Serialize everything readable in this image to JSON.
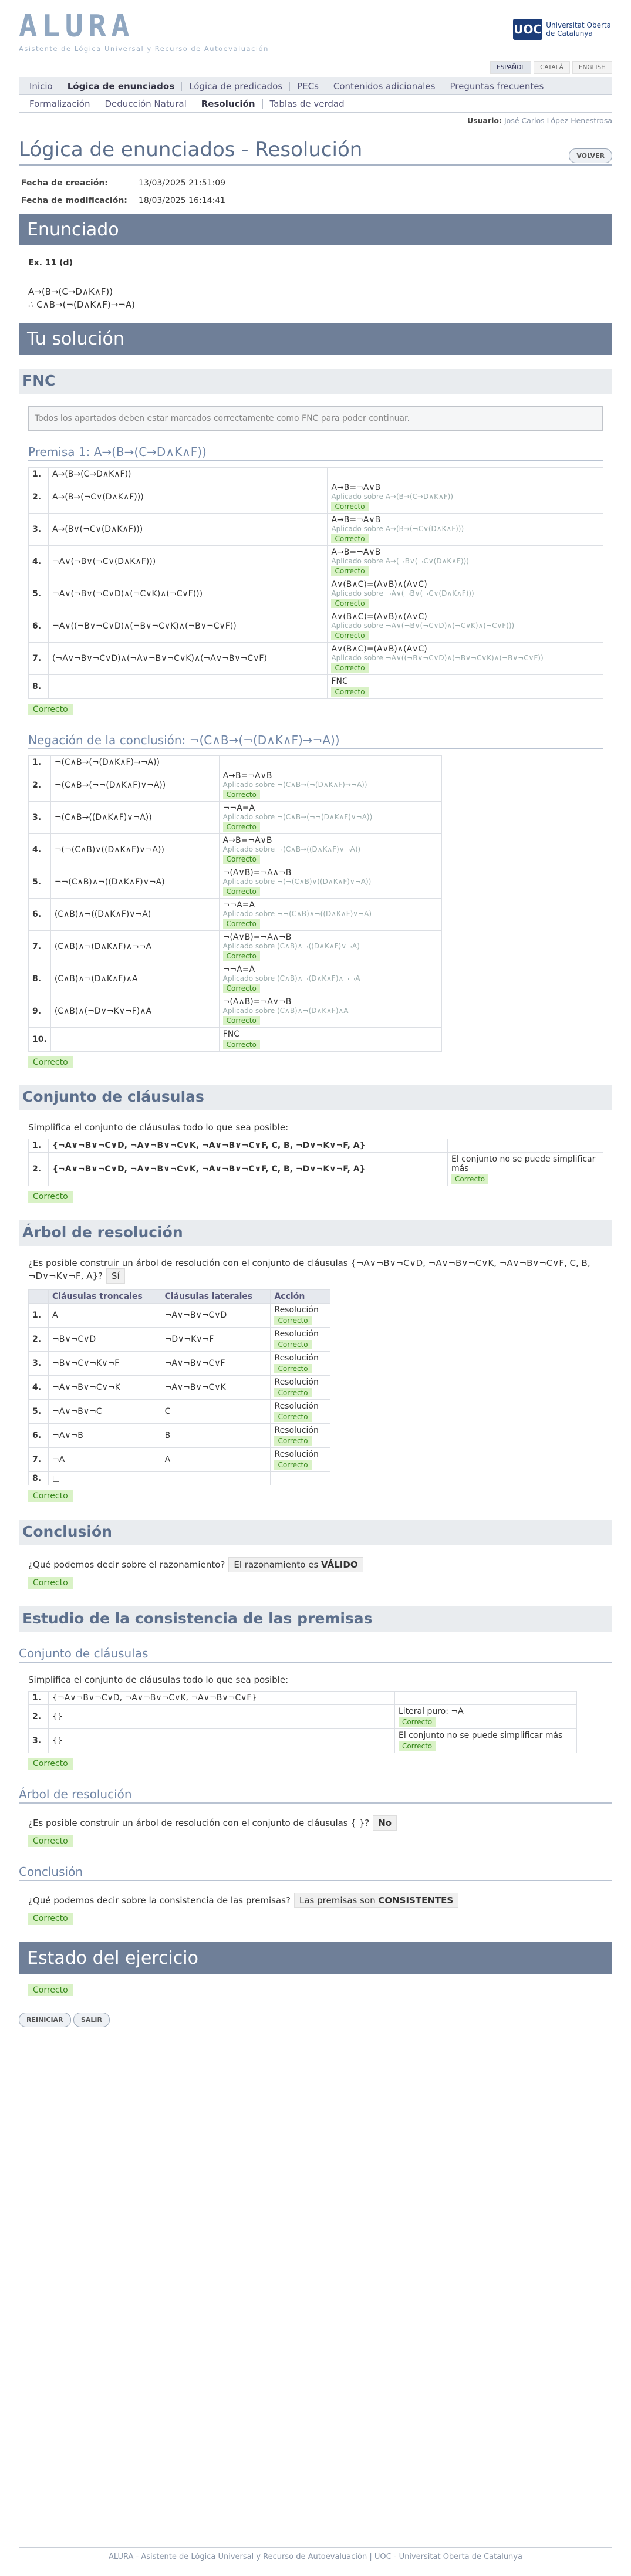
{
  "header": {
    "logo": "ALURA",
    "logo_sub": "Asistente de Lógica Universal y Recurso de Autoevaluación",
    "uoc_mark": "UOC",
    "uoc_line1": "Universitat Oberta",
    "uoc_line2": "de Catalunya"
  },
  "langs": [
    "ESPAÑOL",
    "CATALÀ",
    "ENGLISH"
  ],
  "menu": [
    "Inicio",
    "Lógica de enunciados",
    "Lógica de predicados",
    "PECs",
    "Contenidos adicionales",
    "Preguntas frecuentes"
  ],
  "submenu": [
    "Formalización",
    "Deducción Natural",
    "Resolución",
    "Tablas de verdad"
  ],
  "user": {
    "label": "Usuario:",
    "name": "José Carlos López Henestrosa"
  },
  "page_title": "Lógica de enunciados - Resolución",
  "back": "VOLVER",
  "meta": {
    "created_label": "Fecha de creación:",
    "created": "13/03/2025 21:51:09",
    "modified_label": "Fecha de modificación:",
    "modified": "18/03/2025 16:14:41"
  },
  "enunciado": {
    "title": "Enunciado",
    "ex": "Ex. 11 (d)",
    "l1": "A→(B→(C→D∧K∧F))",
    "l2": "∴ C∧B→(¬(D∧K∧F)→¬A)"
  },
  "solution_title": "Tu solución",
  "fnc": {
    "title": "FNC",
    "notice": "Todos los apartados deben estar marcados correctamente como FNC para poder continuar."
  },
  "premisa": {
    "title": "Premisa 1: A→(B→(C→D∧K∧F))",
    "rows": [
      [
        "1.",
        "A→(B→(C→D∧K∧F))",
        "",
        "",
        ""
      ],
      [
        "2.",
        "A→(B→(¬C∨(D∧K∧F)))",
        "A→B=¬A∨B",
        "Aplicado sobre A→(B→(C→D∧K∧F))",
        "Correcto"
      ],
      [
        "3.",
        "A→(B∨(¬C∨(D∧K∧F)))",
        "A→B=¬A∨B",
        "Aplicado sobre A→(B→(¬C∨(D∧K∧F)))",
        "Correcto"
      ],
      [
        "4.",
        "¬A∨(¬B∨(¬C∨(D∧K∧F)))",
        "A→B=¬A∨B",
        "Aplicado sobre A→(¬B∨(¬C∨(D∧K∧F)))",
        "Correcto"
      ],
      [
        "5.",
        "¬A∨(¬B∨(¬C∨D)∧(¬C∨K)∧(¬C∨F)))",
        "A∨(B∧C)=(A∨B)∧(A∨C)",
        "Aplicado sobre ¬A∨(¬B∨(¬C∨(D∧K∧F)))",
        "Correcto"
      ],
      [
        "6.",
        "¬A∨((¬B∨¬C∨D)∧(¬B∨¬C∨K)∧(¬B∨¬C∨F))",
        "A∨(B∧C)=(A∨B)∧(A∨C)",
        "Aplicado sobre ¬A∨(¬B∨(¬C∨D)∧(¬C∨K)∧(¬C∨F)))",
        "Correcto"
      ],
      [
        "7.",
        "(¬A∨¬B∨¬C∨D)∧(¬A∨¬B∨¬C∨K)∧(¬A∨¬B∨¬C∨F)",
        "A∨(B∧C)=(A∨B)∧(A∨C)",
        "Aplicado sobre ¬A∨((¬B∨¬C∨D)∧(¬B∨¬C∨K)∧(¬B∨¬C∨F))",
        "Correcto"
      ],
      [
        "8.",
        "",
        "FNC",
        "",
        "Correcto"
      ]
    ],
    "ok": "Correcto"
  },
  "negacion": {
    "title": "Negación de la conclusión: ¬(C∧B→(¬(D∧K∧F)→¬A))",
    "rows": [
      [
        "1.",
        "¬(C∧B→(¬(D∧K∧F)→¬A))",
        "",
        "",
        ""
      ],
      [
        "2.",
        "¬(C∧B→(¬¬(D∧K∧F)∨¬A))",
        "A→B=¬A∨B",
        "Aplicado sobre ¬(C∧B→(¬(D∧K∧F)→¬A))",
        "Correcto"
      ],
      [
        "3.",
        "¬(C∧B→((D∧K∧F)∨¬A))",
        "¬¬A=A",
        "Aplicado sobre ¬(C∧B→(¬¬(D∧K∧F)∨¬A))",
        "Correcto"
      ],
      [
        "4.",
        "¬(¬(C∧B)∨((D∧K∧F)∨¬A))",
        "A→B=¬A∨B",
        "Aplicado sobre ¬(C∧B→((D∧K∧F)∨¬A))",
        "Correcto"
      ],
      [
        "5.",
        "¬¬(C∧B)∧¬((D∧K∧F)∨¬A)",
        "¬(A∨B)=¬A∧¬B",
        "Aplicado sobre ¬(¬(C∧B)∨((D∧K∧F)∨¬A))",
        "Correcto"
      ],
      [
        "6.",
        "(C∧B)∧¬((D∧K∧F)∨¬A)",
        "¬¬A=A",
        "Aplicado sobre ¬¬(C∧B)∧¬((D∧K∧F)∨¬A)",
        "Correcto"
      ],
      [
        "7.",
        "(C∧B)∧¬(D∧K∧F)∧¬¬A",
        "¬(A∨B)=¬A∧¬B",
        "Aplicado sobre (C∧B)∧¬((D∧K∧F)∨¬A)",
        "Correcto"
      ],
      [
        "8.",
        "(C∧B)∧¬(D∧K∧F)∧A",
        "¬¬A=A",
        "Aplicado sobre (C∧B)∧¬(D∧K∧F)∧¬¬A",
        "Correcto"
      ],
      [
        "9.",
        "(C∧B)∧(¬D∨¬K∨¬F)∧A",
        "¬(A∧B)=¬A∨¬B",
        "Aplicado sobre (C∧B)∧¬(D∧K∧F)∧A",
        "Correcto"
      ],
      [
        "10.",
        "",
        "FNC",
        "",
        "Correcto"
      ]
    ],
    "ok": "Correcto"
  },
  "conjunto": {
    "title": "Conjunto de cláusulas",
    "prompt": "Simplifica el conjunto de cláusulas todo lo que sea posible:",
    "r1": "{¬A∨¬B∨¬C∨D, ¬A∨¬B∨¬C∨K, ¬A∨¬B∨¬C∨F, C, B, ¬D∨¬K∨¬F, A}",
    "r2": "{¬A∨¬B∨¬C∨D, ¬A∨¬B∨¬C∨K, ¬A∨¬B∨¬C∨F, C, B, ¬D∨¬K∨¬F, A}",
    "r2_note": "El conjunto no se puede simplificar más",
    "ok": "Correcto"
  },
  "arbol": {
    "title": "Árbol de resolución",
    "q": "¿Es posible construir un árbol de resolución con el conjunto de cláusulas {¬A∨¬B∨¬C∨D, ¬A∨¬B∨¬C∨K, ¬A∨¬B∨¬C∨F, C, B, ¬D∨¬K∨¬F, A}?",
    "ans": "Sí",
    "cols": [
      "Cláusulas troncales",
      "Cláusulas laterales",
      "Acción"
    ],
    "rows": [
      [
        "1.",
        "A",
        "¬A∨¬B∨¬C∨D",
        "Resolución",
        "Correcto"
      ],
      [
        "2.",
        "¬B∨¬C∨D",
        "¬D∨¬K∨¬F",
        "Resolución",
        "Correcto"
      ],
      [
        "3.",
        "¬B∨¬C∨¬K∨¬F",
        "¬A∨¬B∨¬C∨F",
        "Resolución",
        "Correcto"
      ],
      [
        "4.",
        "¬A∨¬B∨¬C∨¬K",
        "¬A∨¬B∨¬C∨K",
        "Resolución",
        "Correcto"
      ],
      [
        "5.",
        "¬A∨¬B∨¬C",
        "C",
        "Resolución",
        "Correcto"
      ],
      [
        "6.",
        "¬A∨¬B",
        "B",
        "Resolución",
        "Correcto"
      ],
      [
        "7.",
        "¬A",
        "A",
        "Resolución",
        "Correcto"
      ],
      [
        "8.",
        "□",
        "",
        "",
        ""
      ]
    ],
    "ok": "Correcto"
  },
  "conclusion": {
    "title": "Conclusión",
    "q": "¿Qué podemos decir sobre el razonamiento?",
    "ans_pre": "El razonamiento es ",
    "ans": "VÁLIDO",
    "ok": "Correcto"
  },
  "estudio": {
    "title": "Estudio de la consistencia de las premisas",
    "sub1": "Conjunto de cláusulas",
    "prompt": "Simplifica el conjunto de cláusulas todo lo que sea posible:",
    "rows": [
      [
        "1.",
        "{¬A∨¬B∨¬C∨D, ¬A∨¬B∨¬C∨K, ¬A∨¬B∨¬C∨F}",
        "",
        ""
      ],
      [
        "2.",
        "{}",
        "Literal puro: ¬A",
        "Correcto"
      ],
      [
        "3.",
        "{}",
        "El conjunto no se puede simplificar más",
        "Correcto"
      ]
    ],
    "ok": "Correcto",
    "sub2": "Árbol de resolución",
    "q2": "¿Es posible construir un árbol de resolución con el conjunto de cláusulas { }?",
    "ans2": "No",
    "ok2": "Correcto",
    "sub3": "Conclusión",
    "q3": "¿Qué podemos decir sobre la consistencia de las premisas?",
    "ans3_pre": "Las premisas son ",
    "ans3": "CONSISTENTES",
    "ok3": "Correcto"
  },
  "estado": {
    "title": "Estado del ejercicio",
    "ok": "Correcto"
  },
  "buttons": {
    "reset": "REINICIAR",
    "exit": "SALIR"
  },
  "footer": "ALURA - Asistente de Lógica Universal y Recurso de Autoevaluación | UOC - Universitat Oberta de Catalunya"
}
